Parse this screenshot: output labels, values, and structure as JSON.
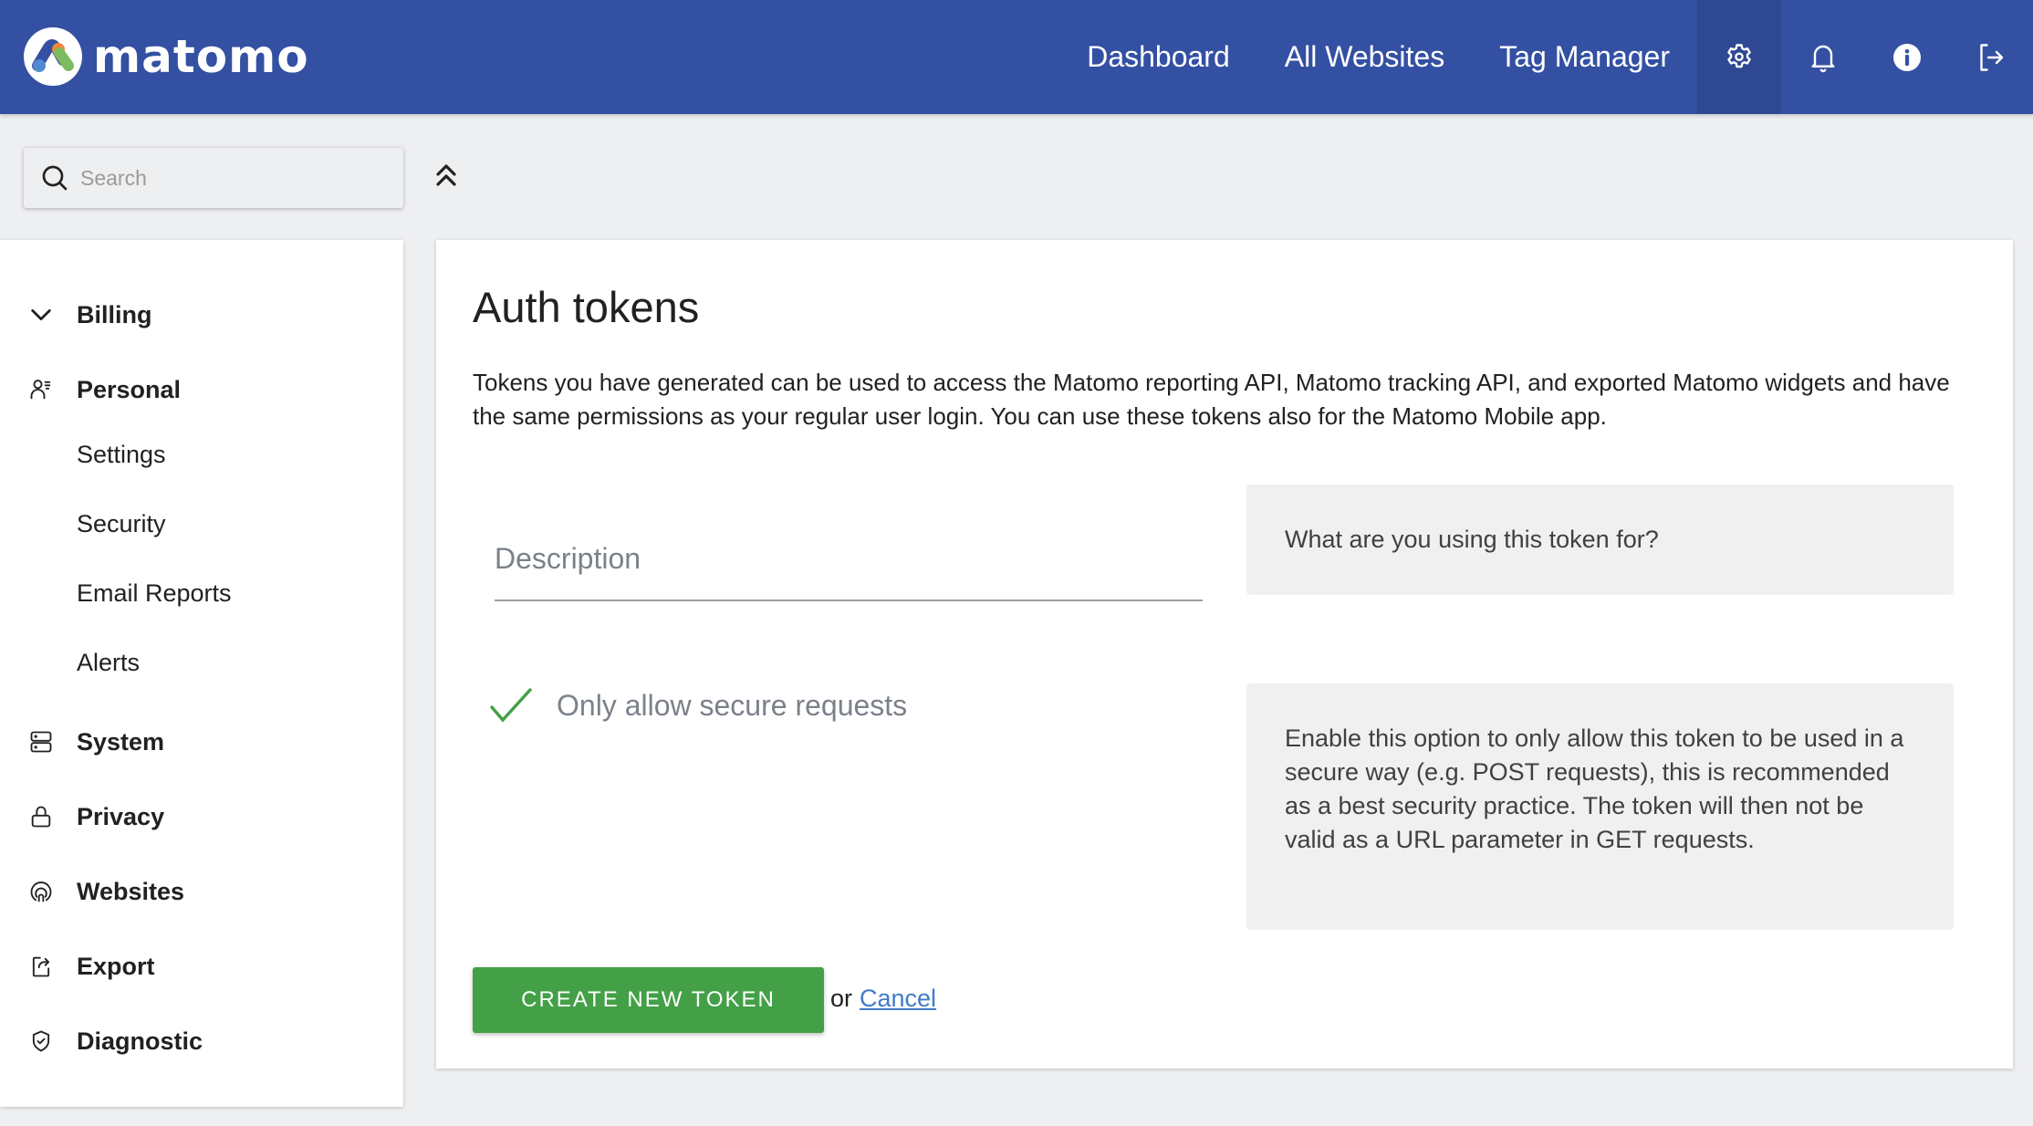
{
  "header": {
    "logo_text": "matomo",
    "nav": [
      "Dashboard",
      "All Websites",
      "Tag Manager"
    ],
    "icons": [
      "gear-icon",
      "bell-icon",
      "info-icon",
      "logout-icon"
    ],
    "active_icon": "gear-icon",
    "color": "#3450a3"
  },
  "search": {
    "placeholder": "Search",
    "value": ""
  },
  "sidebar": {
    "items": [
      {
        "label": "Billing",
        "icon": "chevron-down-icon",
        "type": "section"
      },
      {
        "label": "Personal",
        "icon": "user-list-icon",
        "type": "section"
      },
      {
        "label": "Settings",
        "type": "sub"
      },
      {
        "label": "Security",
        "type": "sub"
      },
      {
        "label": "Email Reports",
        "type": "sub"
      },
      {
        "label": "Alerts",
        "type": "sub"
      },
      {
        "label": "System",
        "icon": "server-icon",
        "type": "section"
      },
      {
        "label": "Privacy",
        "icon": "lock-icon",
        "type": "section"
      },
      {
        "label": "Websites",
        "icon": "websites-icon",
        "type": "section"
      },
      {
        "label": "Export",
        "icon": "export-icon",
        "type": "section"
      },
      {
        "label": "Diagnostic",
        "icon": "shield-check-icon",
        "type": "section"
      }
    ]
  },
  "main": {
    "title": "Auth tokens",
    "intro": "Tokens you have generated can be used to access the Matomo reporting API, Matomo tracking API, and exported Matomo widgets and have the same permissions as your regular user login. You can use these tokens also for the Matomo Mobile app.",
    "description_field": {
      "placeholder": "Description",
      "value": ""
    },
    "description_help": "What are you using this token for?",
    "secure_checkbox": {
      "label": "Only allow secure requests",
      "checked": true
    },
    "secure_help": "Enable this option to only allow this token to be used in a secure way (e.g. POST requests), this is recommended as a best security practice. The token will then not be valid as a URL parameter in GET requests.",
    "create_button": "CREATE NEW TOKEN",
    "or_text": "or",
    "cancel_link": "Cancel",
    "accent_green": "#43a047",
    "link_color": "#3f7bc7"
  }
}
